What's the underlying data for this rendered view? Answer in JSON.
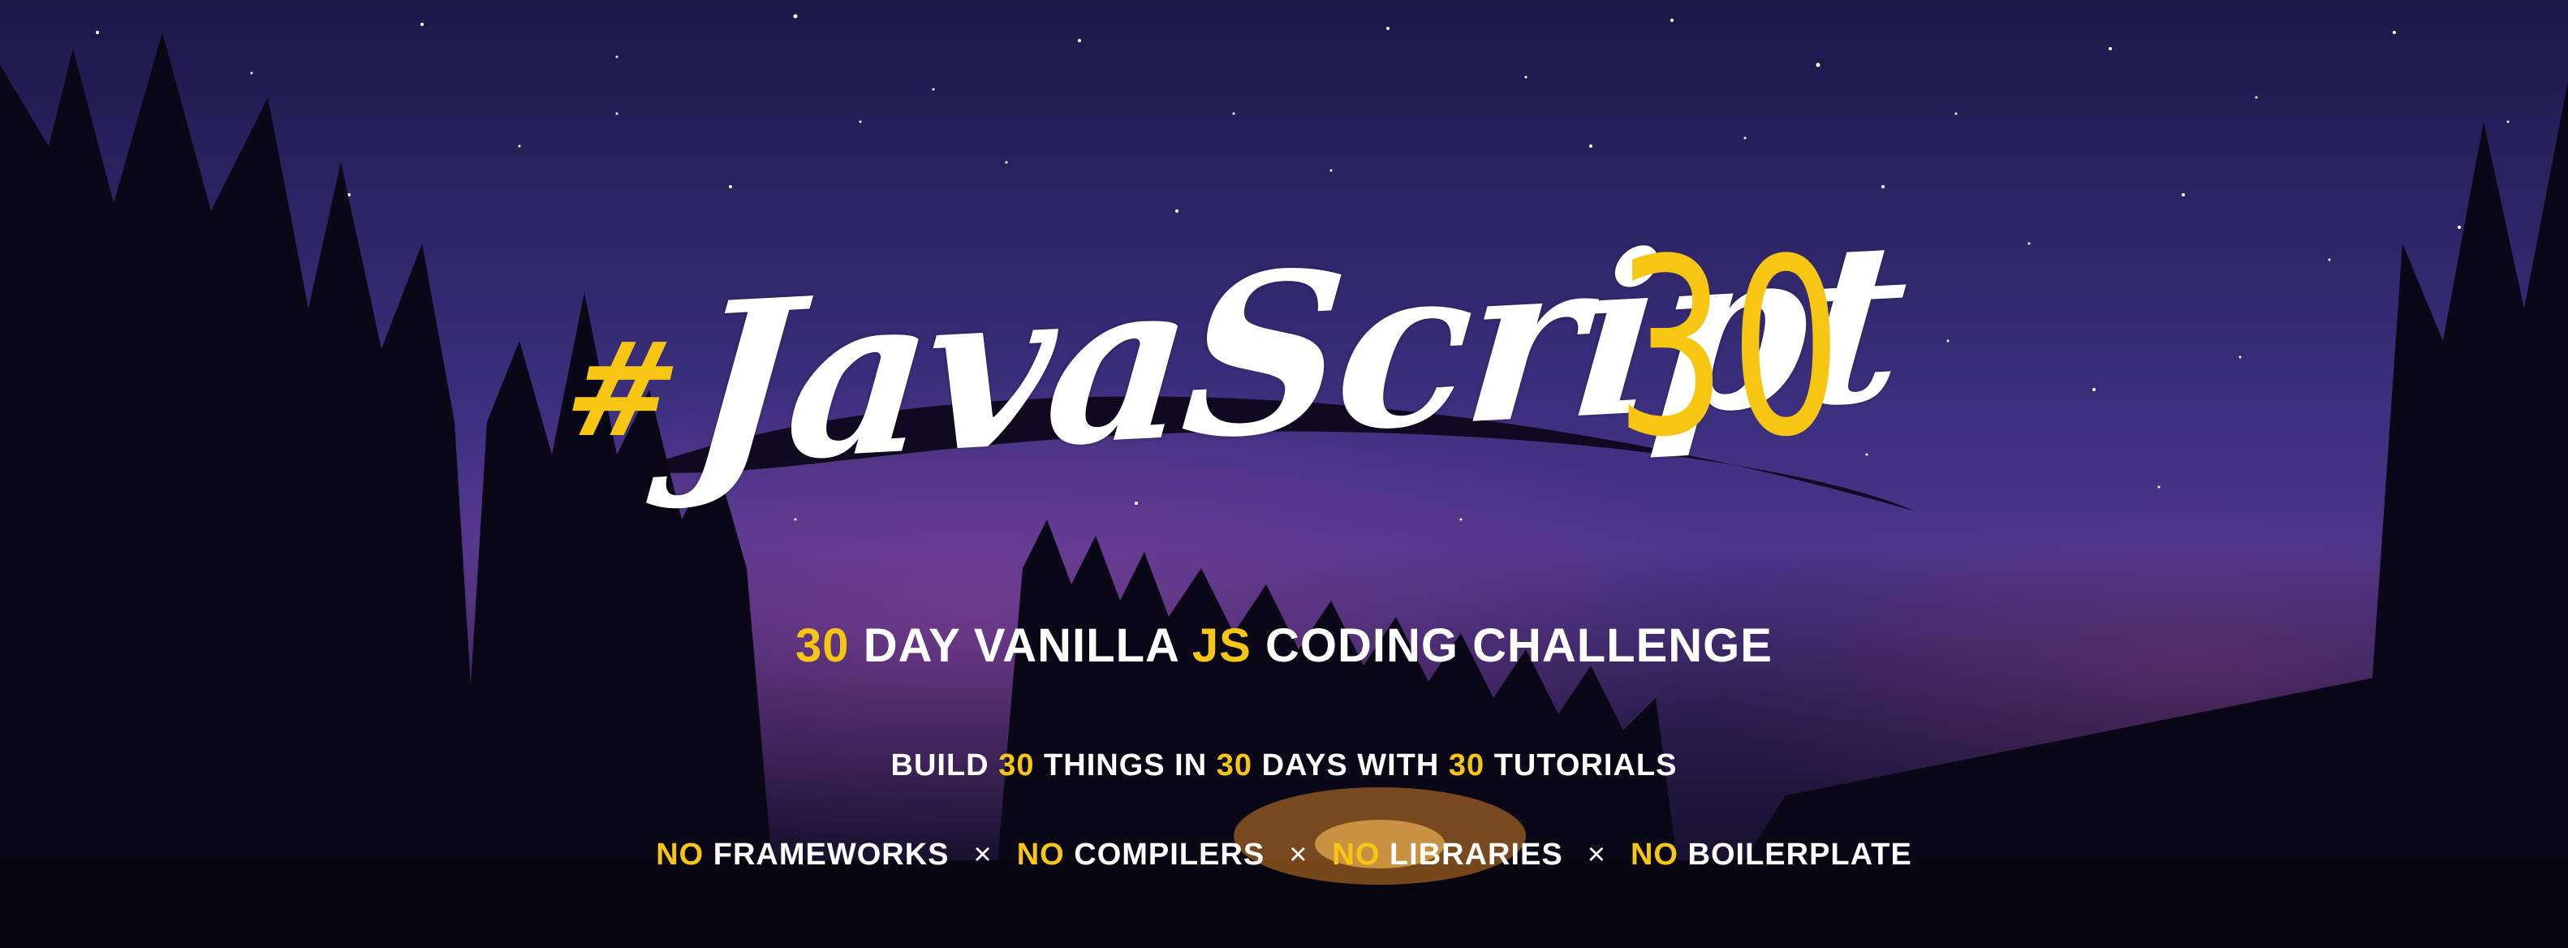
{
  "brand": {
    "hash": "#",
    "word": "JavaScript",
    "number": "30"
  },
  "subtitle": {
    "num": "30",
    "part1": "DAY VANILLA",
    "js": "JS",
    "part2": "CODING CHALLENGE"
  },
  "tagline": {
    "build": "BUILD",
    "n1": "30",
    "things": "THINGS IN",
    "n2": "30",
    "days": "DAYS WITH",
    "n3": "30",
    "tutorials": "TUTORIALS"
  },
  "rules": {
    "items": [
      {
        "no": "NO",
        "label": "FRAMEWORKS"
      },
      {
        "no": "NO",
        "label": "COMPILERS"
      },
      {
        "no": "NO",
        "label": "LIBRARIES"
      },
      {
        "no": "NO",
        "label": "BOILERPLATE"
      }
    ],
    "separator": "×"
  },
  "colors": {
    "accent": "#f7c613",
    "text": "#ffffff",
    "sky_top": "#1d1747",
    "sky_mid": "#3b2f7d",
    "fire": "#ff9a28"
  }
}
